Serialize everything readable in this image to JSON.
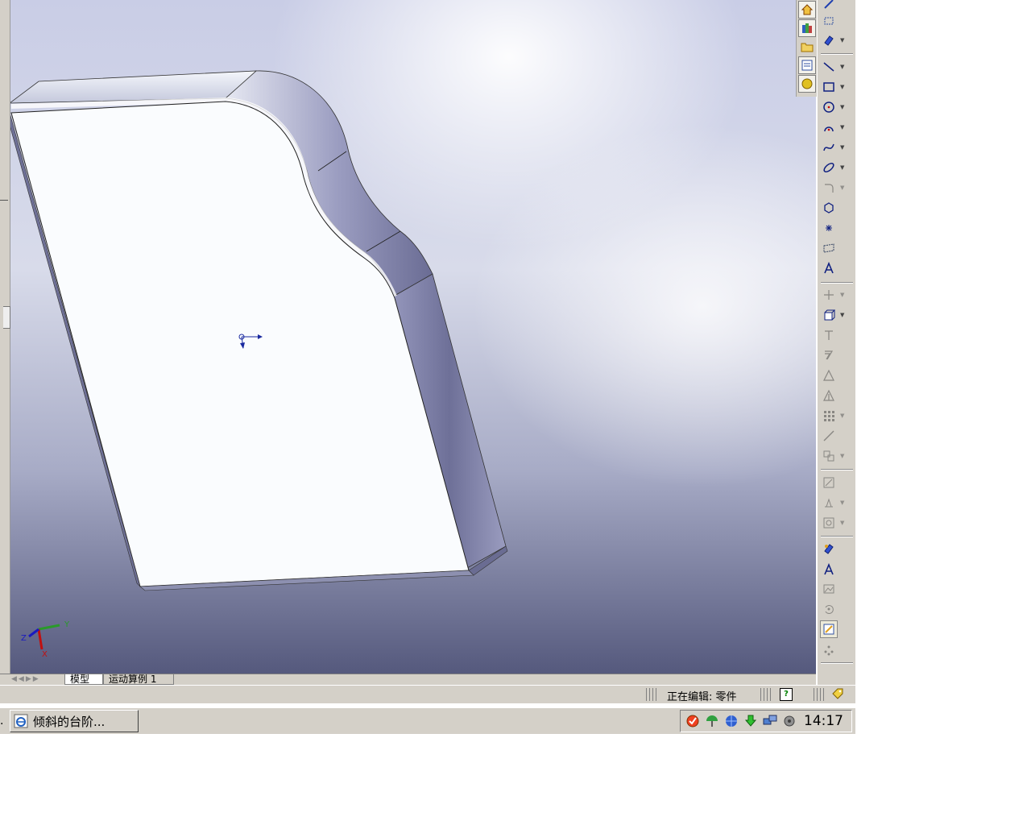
{
  "document_tabs": {
    "model": "模型",
    "motion_study": "运动算例 1"
  },
  "statusbar": {
    "editing": "正在编辑: 零件",
    "help_icon_text": "?"
  },
  "taskbar": {
    "ellipsis": ".",
    "window_title": "倾斜的台阶...",
    "clock": "14:17"
  },
  "triad": {
    "x_label": "X",
    "y_label": "Y",
    "z_label": "Z"
  },
  "colors": {
    "viewport_top": "#c9cde6",
    "viewport_bottom": "#55597d",
    "chrome": "#d4d0c8",
    "part_face": "#fafcfe",
    "part_side": "#7e80a6"
  },
  "right_toolbar_icons": [
    "smart-dimension-icon",
    "line-icon",
    "rectangle-icon",
    "circle-icon",
    "arc-icon",
    "spline-icon",
    "ellipse-icon",
    "fillet-icon",
    "polygon-icon",
    "point-icon",
    "plane-icon",
    "text-icon",
    "trim-icon",
    "offset-icon",
    "convert-entities-icon",
    "mirror-icon",
    "linear-pattern-icon",
    "move-entities-icon",
    "relations-icon",
    "repair-sketch-icon",
    "rapid-sketch-icon",
    "instant3d-icon"
  ]
}
